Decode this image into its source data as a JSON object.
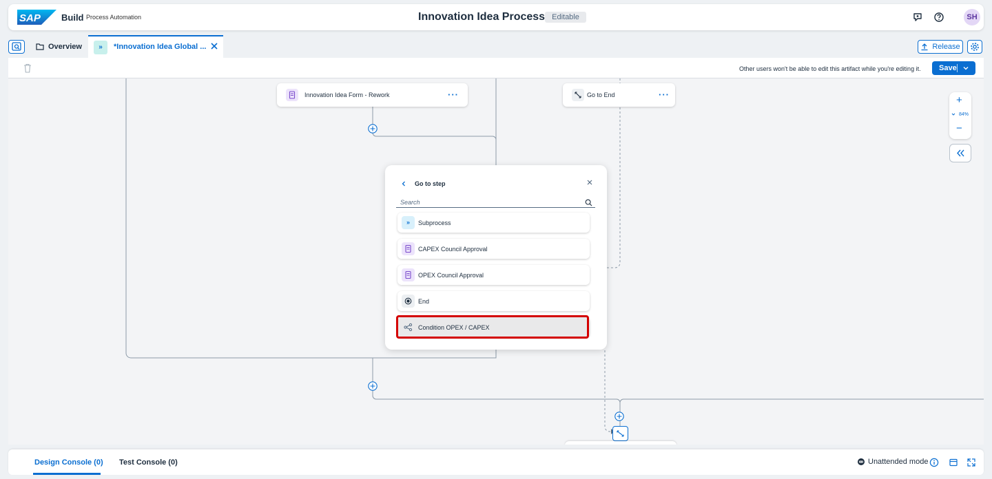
{
  "shell": {
    "logo_text": "SAP",
    "product": "Build",
    "subtitle": "Process Automation",
    "title": "Innovation Idea Process",
    "status": "Editable",
    "avatar_initials": "SH",
    "icons": [
      "feedback-icon",
      "help-icon"
    ]
  },
  "tabs": {
    "overview_label": "Overview",
    "active_label": "*Innovation Idea Global ...",
    "release_label": "Release"
  },
  "toolbar": {
    "lock_message": "Other users won't be able to edit this artifact while you're editing it.",
    "save_label": "Save"
  },
  "canvas": {
    "nodes": [
      {
        "label": "Innovation Idea Form - Rework",
        "icon": "form-icon"
      },
      {
        "label": "Go to End",
        "icon": "goto-icon"
      }
    ],
    "zoom": "84%"
  },
  "popover": {
    "title": "Go to step",
    "search_placeholder": "Search",
    "items": [
      {
        "label": "Subprocess",
        "icon": "subprocess-icon"
      },
      {
        "label": "CAPEX Council Approval",
        "icon": "form-icon"
      },
      {
        "label": "OPEX Council Approval",
        "icon": "form-icon"
      },
      {
        "label": "End",
        "icon": "end-icon"
      },
      {
        "label": "Condition OPEX / CAPEX",
        "icon": "condition-icon",
        "selected": true
      }
    ]
  },
  "console": {
    "design_tab": "Design Console (0)",
    "test_tab": "Test Console (0)",
    "mode_label": "Unattended mode"
  },
  "colors": {
    "accent": "#0a6ed1",
    "highlight": "#d40000",
    "form_icon_bg": "#ece3fb",
    "subprocess_icon_bg": "#c8f0ec"
  }
}
